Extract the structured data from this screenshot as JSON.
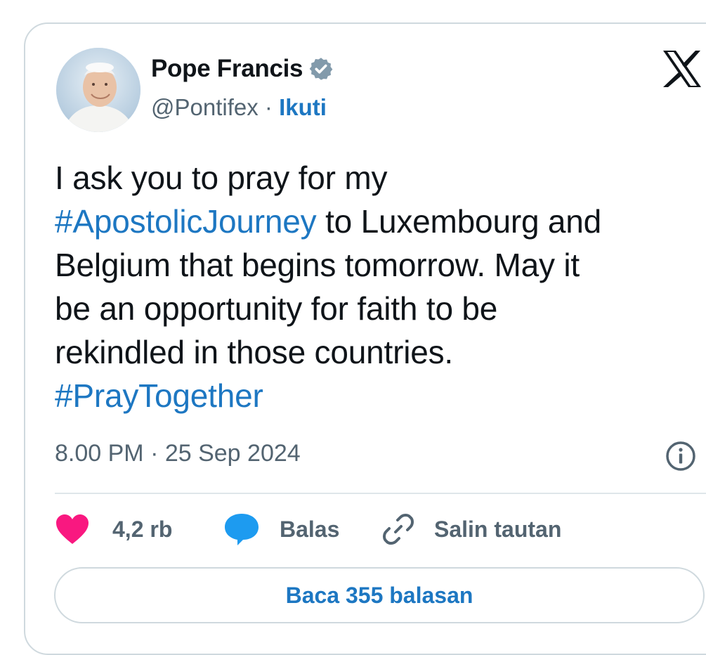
{
  "author": {
    "name": "Pope Francis",
    "handle": "@Pontifex",
    "separator": " · ",
    "follow_label": "Ikuti"
  },
  "tweet": {
    "text_line1": "I ask you to pray for my",
    "hashtag1": "#ApostolicJourney",
    "text_after_hashtag1": " to Luxembourg and",
    "text_line3": "Belgium that begins tomorrow. May it",
    "text_line4": "be an opportunity for faith to be",
    "text_line5": "rekindled in those countries.",
    "hashtag2": "#PrayTogether",
    "timestamp": "8.00 PM · 25 Sep 2024"
  },
  "actions": {
    "like_count": "4,2 rb",
    "reply_label": "Balas",
    "copy_link_label": "Salin tautan"
  },
  "read_replies_label": "Baca 355 balasan",
  "icons": {
    "brand": "x-logo-icon",
    "verified": "verified-badge-icon",
    "info": "info-icon",
    "like": "heart-icon",
    "reply": "speech-bubble-icon",
    "copy_link": "link-icon"
  },
  "colors": {
    "link_blue": "#1d77c2",
    "heart_pink": "#f91880",
    "reply_blue": "#1d9bf0",
    "muted_text": "#536471",
    "text": "#0f1419",
    "border": "#cfd9de"
  }
}
